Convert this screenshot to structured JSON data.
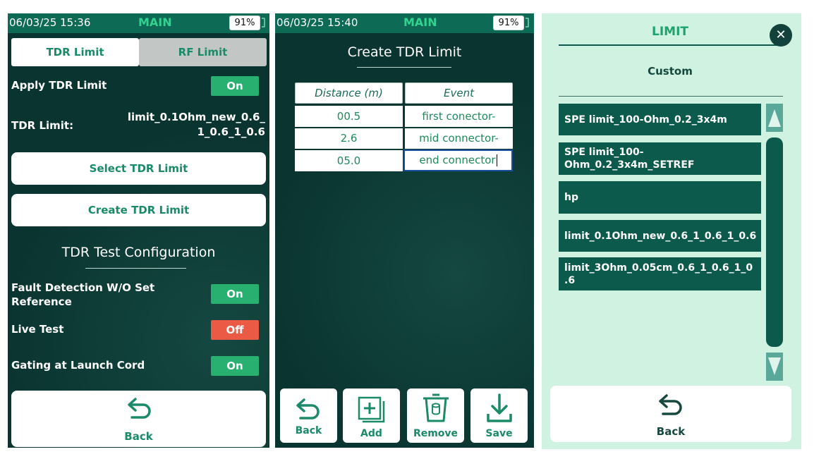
{
  "screen1": {
    "status": {
      "time": "06/03/25 15:36",
      "mode": "MAIN",
      "battery": "91%"
    },
    "tabs": {
      "tdr": "TDR Limit",
      "rf": "RF Limit"
    },
    "apply_label": "Apply TDR Limit",
    "apply_value": "On",
    "limit_label": "TDR Limit:",
    "limit_value_line1": "limit_0.1Ohm_new_0.6_",
    "limit_value_line2": "1_0.6_1_0.6",
    "select_button": "Select TDR Limit",
    "create_button": "Create TDR Limit",
    "section_title": "TDR Test Configuration",
    "settings": [
      {
        "label_line1": "Fault Detection W/O Set",
        "label_line2": "Reference",
        "value": "On"
      },
      {
        "label_line1": "Live Test",
        "label_line2": "",
        "value": "Off"
      },
      {
        "label_line1": "Gating at Launch Cord",
        "label_line2": "",
        "value": "On"
      }
    ],
    "back_label": "Back"
  },
  "screen2": {
    "status": {
      "time": "06/03/25 15:40",
      "mode": "MAIN",
      "battery": "91%"
    },
    "title": "Create TDR Limit",
    "table": {
      "headers": [
        "Distance (m)",
        "Event"
      ],
      "rows": [
        [
          "00.5",
          "first conector-"
        ],
        [
          "2.6",
          "mid connector-"
        ],
        [
          "05.0",
          "end connector"
        ]
      ]
    },
    "toolbar": {
      "back": "Back",
      "add": "Add",
      "remove": "Remove",
      "save": "Save"
    }
  },
  "screen3": {
    "title": "LIMIT",
    "subtitle": "Custom",
    "items": [
      {
        "line1": "SPE limit_100-Ohm_0.2_3x4m",
        "line2": ""
      },
      {
        "line1": "SPE limit_100-",
        "line2": "Ohm_0.2_3x4m_SETREF"
      },
      {
        "line1": "hp",
        "line2": ""
      },
      {
        "line1": "limit_0.1Ohm_new_0.6_1_0.6_1_0.6",
        "line2": ""
      },
      {
        "line1": "limit_3Ohm_0.05cm_0.6_1_0.6_1_0",
        "line2": ".6"
      }
    ],
    "back_label": "Back"
  },
  "colors": {
    "panel_bg": "#0a3430",
    "status_bar": "#0d6a55",
    "accent": "#1a8a68",
    "on": "#28b070",
    "off": "#ea5a45",
    "list_bg": "#cff2e1",
    "list_item": "#0c5a4c"
  }
}
